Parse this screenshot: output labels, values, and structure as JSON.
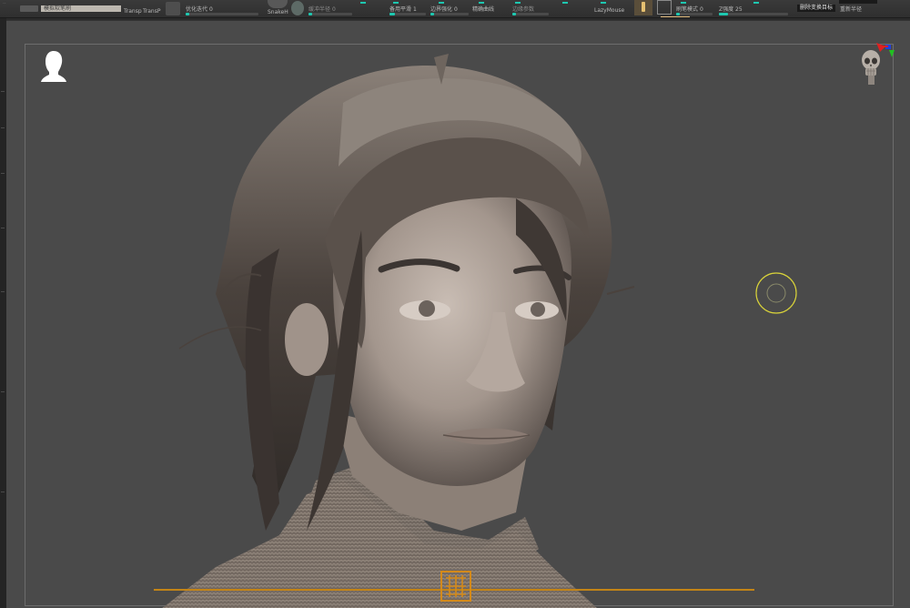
{
  "toolbar": {
    "layer_field": "模拟软笔刷",
    "transp_label": "Transp",
    "trans_pl_label": "TransP",
    "smooth_label": "优化迭代",
    "smooth_value": "0",
    "snakehook_label": "SnakeH",
    "reach_label": "缓冲半径",
    "reach_value": "0",
    "slider_a_label": "备用平滑",
    "slider_a_value": "1",
    "smooth_strength_label": "边界强化",
    "smooth_strength_value": "0",
    "precise_curve_label": "精确曲线",
    "fine_label": "边缘参数",
    "lazymouse_label": "LazyMouse",
    "brush_mode_label": "刷笔模式",
    "brush_mode_value": "0",
    "z_intensity_label": "Z强度",
    "z_intensity_value": "25",
    "remove_target_button": "删除变换目标",
    "redo_radius_label": "重新半径"
  },
  "viewport": {
    "head_icon": "head-silhouette-icon",
    "skull_icon": "skull-icon",
    "axis_gizmo": "axis-gizmo-icon",
    "brush_cursor": "brush-cursor-icon",
    "logo_stamp": "logo-stamp-icon"
  },
  "colors": {
    "accent_teal": "#1ec8b0",
    "timeline_orange": "#c38416",
    "brush_cursor_yellow": "#d9d33a",
    "viewport_bg": "#4a4a4a",
    "frame_border": "#6d6d6d"
  }
}
